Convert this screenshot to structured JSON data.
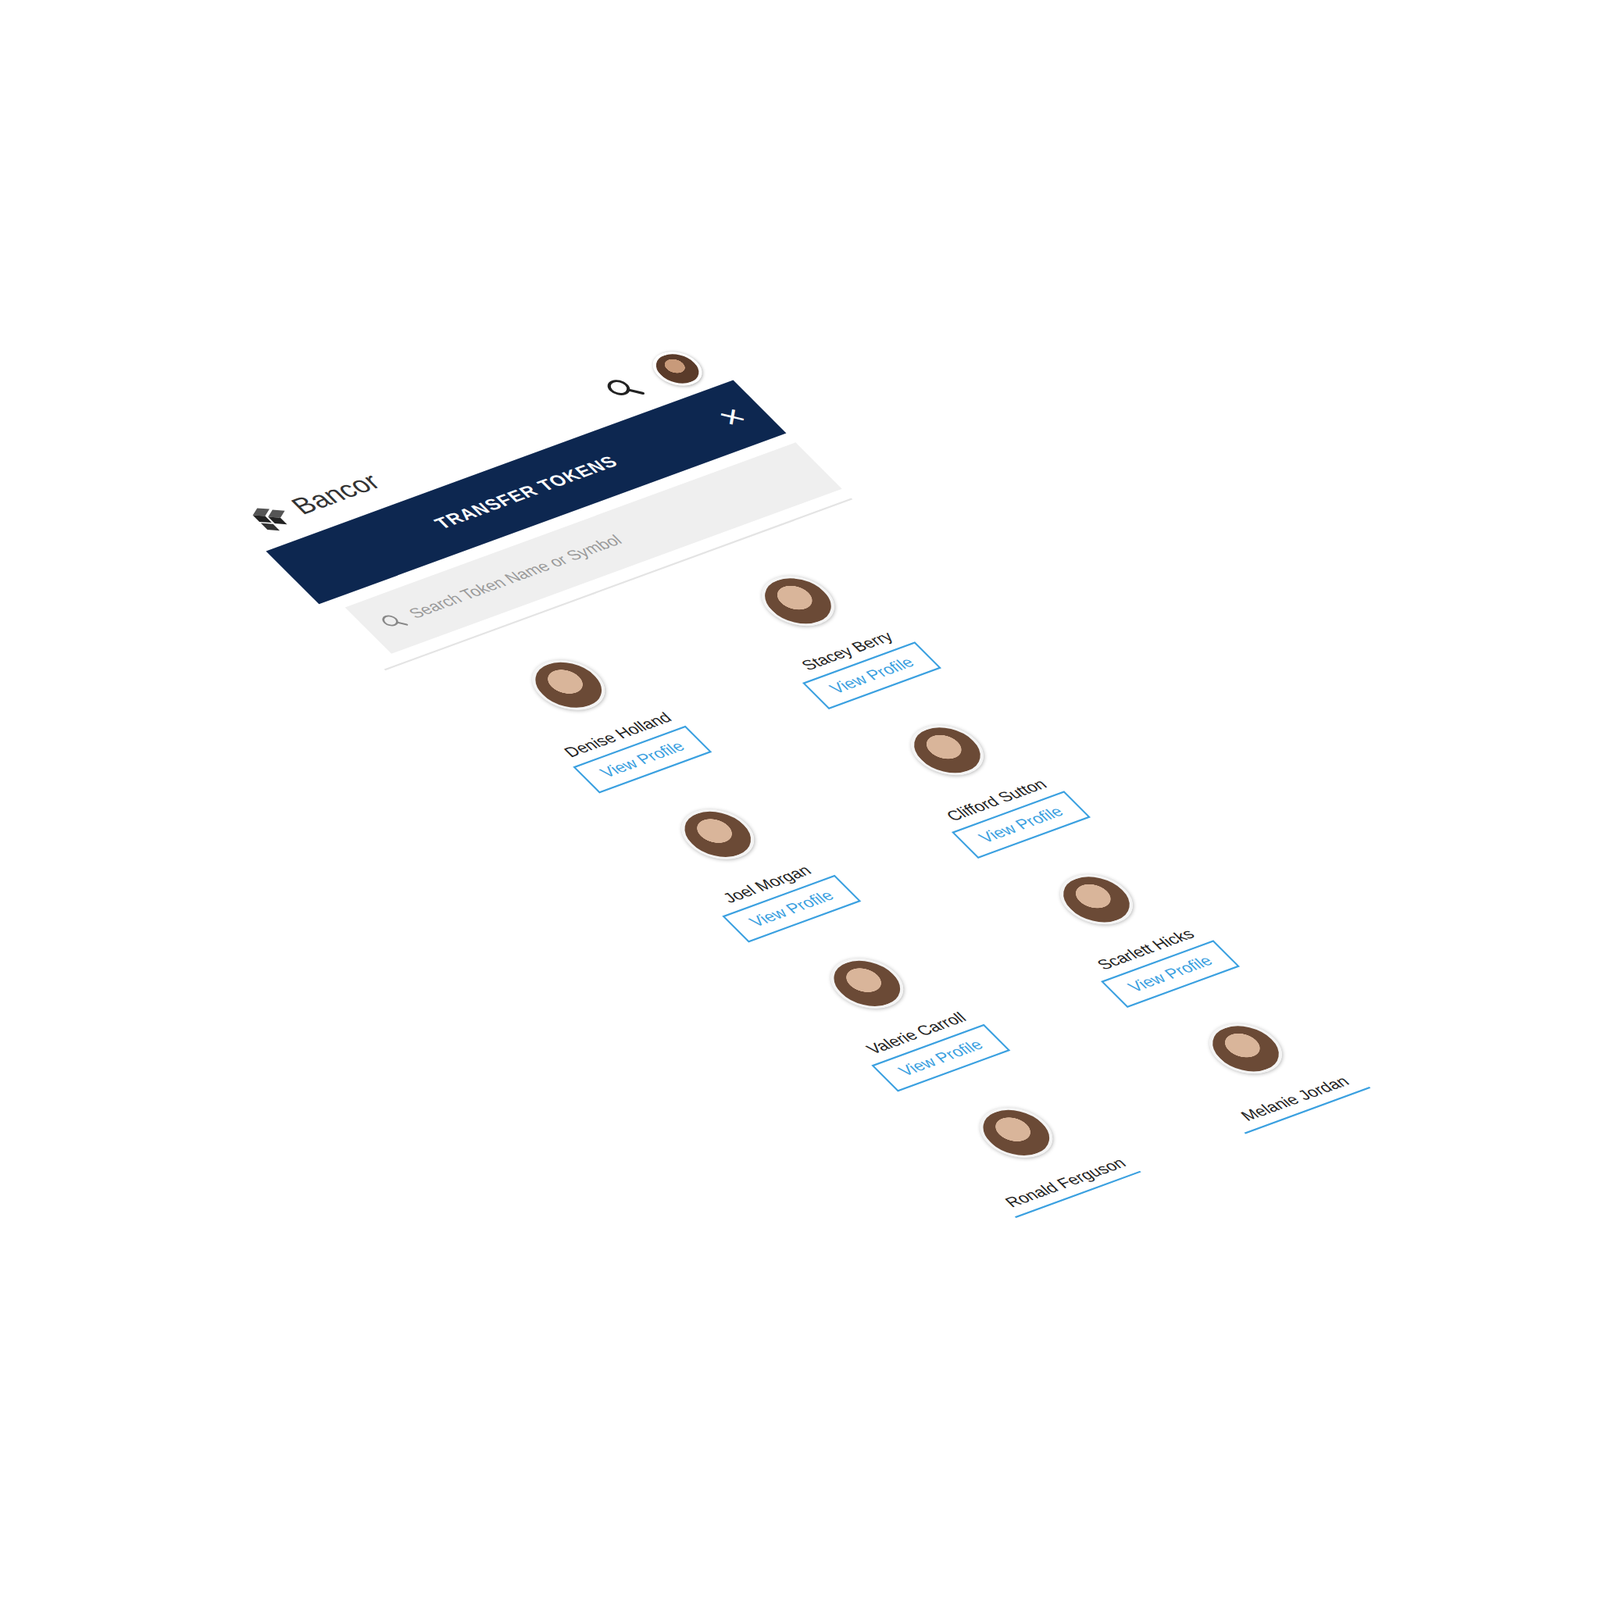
{
  "topbar": {
    "logo": "Bancor"
  },
  "modal": {
    "title": "TRANSFER TOKENS",
    "close": "×"
  },
  "search": {
    "placeholder": "Search Token Name or Symbol"
  },
  "people": [
    {
      "name": "Denise Holland",
      "button": "View Profile"
    },
    {
      "name": "Stacey Berry",
      "button": "View Profile"
    },
    {
      "name": "Joel Morgan",
      "button": "View Profile"
    },
    {
      "name": "Clifford Sutton",
      "button": "View Profile"
    },
    {
      "name": "Valerie Carroll",
      "button": "View Profile"
    },
    {
      "name": "Scarlett Hicks",
      "button": "View Profile"
    },
    {
      "name": "Ronald Ferguson",
      "button": ""
    },
    {
      "name": "Melanie Jordan",
      "button": ""
    }
  ]
}
